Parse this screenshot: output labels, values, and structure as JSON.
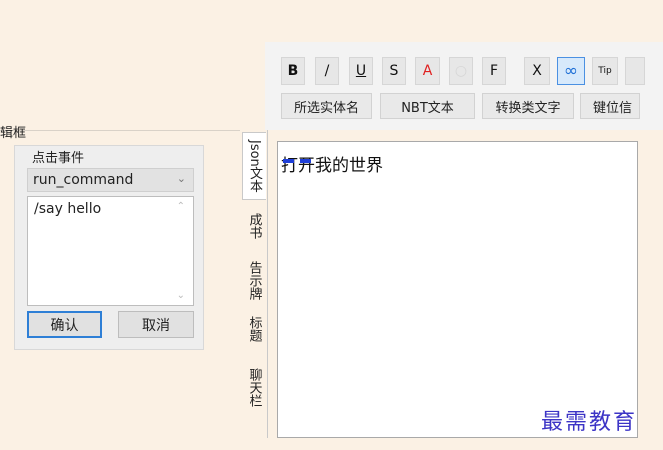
{
  "toolbar": {
    "format_buttons": [
      {
        "label": "B",
        "name": "bold-button"
      },
      {
        "label": "/",
        "name": "italic-button"
      },
      {
        "label": "U",
        "name": "underline-button"
      },
      {
        "label": "S",
        "name": "strikethrough-button"
      },
      {
        "label": "A",
        "name": "text-color-button"
      },
      {
        "label": "○",
        "name": "obfuscate-button"
      },
      {
        "label": "F",
        "name": "font-button"
      },
      {
        "label": "X",
        "name": "clear-format-button"
      },
      {
        "label": "∞",
        "name": "link-button"
      },
      {
        "label": "Tip",
        "name": "tip-button"
      }
    ],
    "tag_buttons": [
      "所选实体名",
      "NBT文本",
      "转换类文字",
      "键位信"
    ]
  },
  "groupbox": {
    "title": "辑框"
  },
  "click_event": {
    "legend": "点击事件",
    "action": "run_command",
    "value": "/say hello",
    "confirm": "确认",
    "cancel": "取消"
  },
  "side_tabs": [
    "Json文本",
    "成书",
    "告示牌",
    "标题",
    "聊天栏"
  ],
  "editor": {
    "text": "打开我的世界"
  },
  "watermark": "最需教育",
  "colors": {
    "accent": "#2e7fd6",
    "text_color_red": "#e02020",
    "marker": "#1f3fd8"
  }
}
